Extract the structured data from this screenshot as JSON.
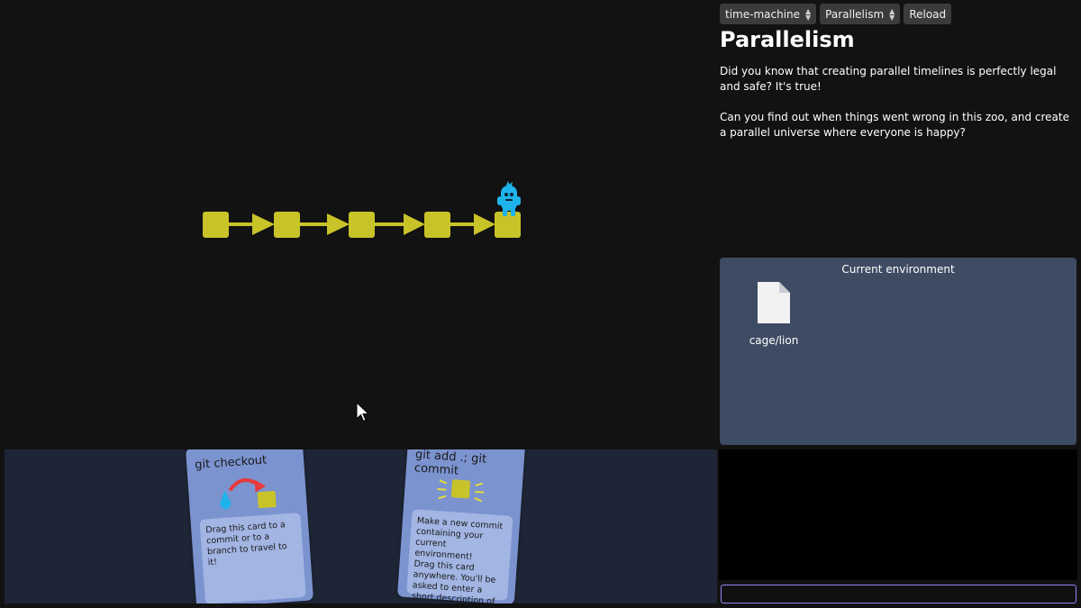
{
  "topbar": {
    "chapter_select": "time-machine",
    "level_select": "Parallelism",
    "reload_label": "Reload"
  },
  "level": {
    "title": "Parallelism",
    "description": [
      "Did you know that creating parallel timelines is perfectly legal and safe? It's true!",
      "Can you find out when things went wrong in this zoo, and create a parallel universe where everyone is happy?"
    ]
  },
  "graph": {
    "commit_count": 5,
    "head_commit_index": 4,
    "commit_color": "#c8c329",
    "head_color": "#1fb3ec"
  },
  "environment": {
    "title": "Current environment",
    "files": [
      {
        "name": "cage/lion",
        "icon": "file-icon"
      }
    ]
  },
  "cards": [
    {
      "title": "git checkout",
      "icon": "checkout-illustration-icon",
      "description": "Drag this card to a commit or to a branch to travel to it!"
    },
    {
      "title": "git add .; git commit",
      "icon": "commit-illustration-icon",
      "description": "Make a new commit containing your current environment!\nDrag this card anywhere. You'll be asked to enter a short description of what you changed."
    }
  ],
  "terminal": {
    "input_value": ""
  },
  "colors": {
    "background": "#121212",
    "card_panel": "#1e2536",
    "card": "#7b93cf",
    "env_panel": "#3d4b63",
    "input_border": "#8f87ff"
  }
}
